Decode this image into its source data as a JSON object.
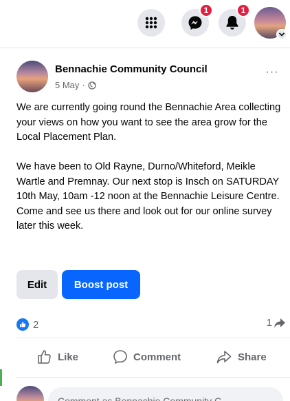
{
  "topbar": {
    "messenger_badge": "1",
    "notifications_badge": "1",
    "icons": {
      "menu": "grid-menu-icon",
      "messenger": "messenger-icon",
      "notifications": "bell-icon",
      "profile_chevron": "chevron-down-icon"
    }
  },
  "post": {
    "page_name": "Bennachie Community Council",
    "date": "5 May",
    "separator": "·",
    "privacy_icon": "globe-icon",
    "more_label": "···",
    "paragraphs": [
      "We are currently going round the Bennachie Area collecting your views on how you want to see the area grow for the Local Placement Plan.",
      "We have been to Old Rayne, Durno/Whiteford, Meikle Wartle and Premnay. Our next stop is Insch on SATURDAY 10th May, 10am -12 noon at the Bennachie Leisure Centre. Come and see us there and look out for our online survey later this week."
    ],
    "edit_label": "Edit",
    "boost_label": "Boost post",
    "reaction_count": "2",
    "share_count": "1"
  },
  "actions": {
    "like_label": "Like",
    "comment_label": "Comment",
    "share_label": "Share"
  },
  "composer": {
    "placeholder": "Comment as Bennachie Community C..."
  },
  "colors": {
    "accent": "#0866ff",
    "like_blue": "#1877f2",
    "badge_red": "#e41e3f",
    "secondary_text": "#65676b",
    "button_grey": "#e4e6eb"
  }
}
